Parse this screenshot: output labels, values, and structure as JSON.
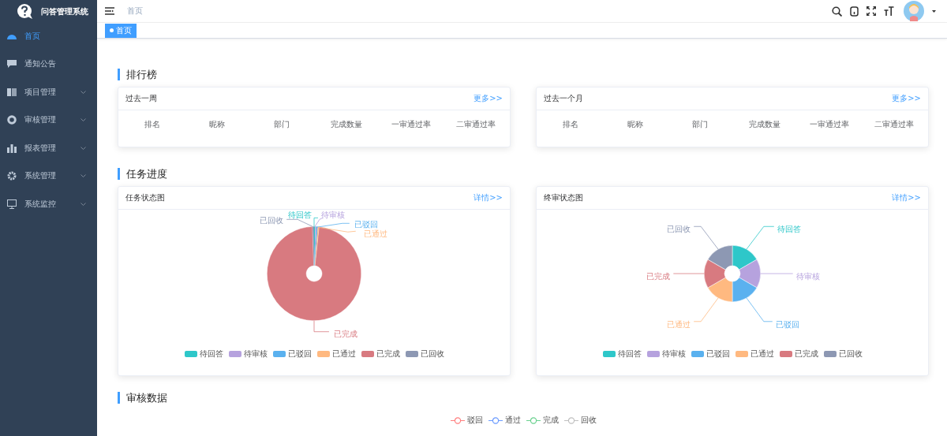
{
  "sidebar": {
    "logo_text": "问答管理系统",
    "items": [
      {
        "label": "首页",
        "selected": true,
        "expandable": false
      },
      {
        "label": "通知公告",
        "selected": false,
        "expandable": false
      },
      {
        "label": "项目管理",
        "selected": false,
        "expandable": true
      },
      {
        "label": "审核管理",
        "selected": false,
        "expandable": true
      },
      {
        "label": "报表管理",
        "selected": false,
        "expandable": true
      },
      {
        "label": "系统管理",
        "selected": false,
        "expandable": true
      },
      {
        "label": "系统监控",
        "selected": false,
        "expandable": true
      }
    ]
  },
  "header": {
    "breadcrumb": "首页"
  },
  "tags": [
    {
      "label": "首页",
      "selected": true
    }
  ],
  "sections": [
    {
      "title": "排行榜",
      "kind": "tables",
      "cards": [
        {
          "title": "过去一周",
          "link": "更多>>",
          "columns": [
            "排名",
            "昵称",
            "部门",
            "完成数量",
            "一审通过率",
            "二审通过率"
          ]
        },
        {
          "title": "过去一个月",
          "link": "更多>>",
          "columns": [
            "排名",
            "昵称",
            "部门",
            "完成数量",
            "一审通过率",
            "二审通过率"
          ]
        }
      ]
    },
    {
      "title": "任务进度",
      "kind": "pies",
      "cards": [
        {
          "title": "任务状态图",
          "link": "详情>>",
          "slice_labels": [
            "待回答",
            "待审核",
            "已驳回",
            "已通过",
            "已完成",
            "已回收"
          ],
          "legend": [
            {
              "label": "待回答",
              "color": "#2ec7c9"
            },
            {
              "label": "待审核",
              "color": "#b6a2de"
            },
            {
              "label": "已驳回",
              "color": "#5ab1ef"
            },
            {
              "label": "已通过",
              "color": "#ffb980"
            },
            {
              "label": "已完成",
              "color": "#d87a80"
            },
            {
              "label": "已回收",
              "color": "#8d98b3"
            }
          ]
        },
        {
          "title": "终审状态图",
          "link": "详情>>",
          "slice_labels": [
            "待回答",
            "待审核",
            "已驳回",
            "已通过",
            "已完成",
            "已回收"
          ],
          "legend": [
            {
              "label": "待回答",
              "color": "#2ec7c9"
            },
            {
              "label": "待审核",
              "color": "#b6a2de"
            },
            {
              "label": "已驳回",
              "color": "#5ab1ef"
            },
            {
              "label": "已通过",
              "color": "#ffb980"
            },
            {
              "label": "已完成",
              "color": "#d87a80"
            },
            {
              "label": "已回收",
              "color": "#8d98b3"
            }
          ]
        }
      ]
    },
    {
      "title": "审核数据",
      "kind": "lines",
      "legend": [
        {
          "label": "驳回",
          "color": "#ff7f7f"
        },
        {
          "label": "通过",
          "color": "#6b9bff"
        },
        {
          "label": "完成",
          "color": "#6ad18f"
        },
        {
          "label": "回收",
          "color": "#c0c0c0"
        }
      ]
    }
  ]
}
